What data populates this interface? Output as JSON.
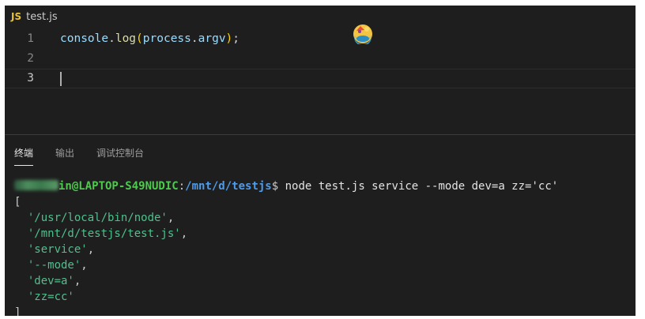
{
  "editor": {
    "tab": {
      "icon_label": "JS",
      "file_name": "test.js"
    },
    "lines": [
      {
        "number": "1",
        "obj": "console",
        "dot1": ".",
        "fn": "log",
        "open": "(",
        "arg_obj": "process",
        "dot2": ".",
        "arg_prop": "argv",
        "close": ")",
        "semi": ";"
      },
      {
        "number": "2"
      },
      {
        "number": "3"
      }
    ]
  },
  "panel": {
    "tabs": [
      "终端",
      "输出",
      "调试控制台"
    ],
    "active_tab": "终端"
  },
  "terminal": {
    "host": "in@LAPTOP-S49NUDIC",
    "colon": ":",
    "path": "/mnt/d/testjs",
    "dollar": "$",
    "command": " node test.js service --mode dev=a zz='cc'",
    "open_bracket": "[",
    "items": [
      "'/usr/local/bin/node'",
      "'/mnt/d/testjs/test.js'",
      "'service'",
      "'--mode'",
      "'dev=a'",
      "'zz=cc'"
    ],
    "close_bracket": "]"
  },
  "colors": {
    "editor_bg": "#1e1e1e",
    "host": "#4ec94e",
    "path": "#4f9be8",
    "string": "#4fc08d"
  },
  "icons": {
    "file_type": "javascript-file-icon",
    "floating": "colorful-emoji-icon"
  }
}
